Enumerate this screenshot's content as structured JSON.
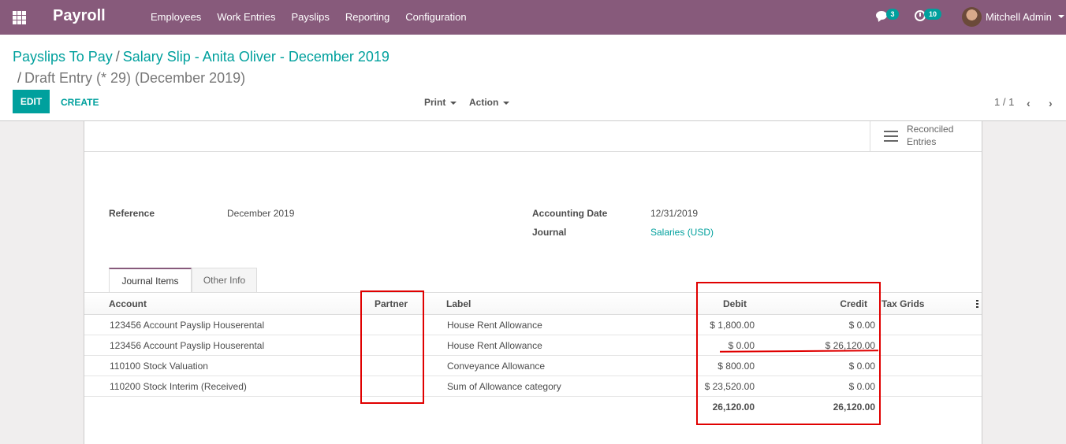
{
  "navbar": {
    "app_title": "Payroll",
    "menu": [
      "Employees",
      "Work Entries",
      "Payslips",
      "Reporting",
      "Configuration"
    ],
    "chat_badge": "3",
    "activity_badge": "10",
    "user_name": "Mitchell Admin",
    "brand_color": "#875a7b"
  },
  "breadcrumb": {
    "parent1": "Payslips To Pay",
    "parent2": "Salary Slip - Anita Oliver - December 2019",
    "current": "Draft Entry (* 29) (December 2019)",
    "separator": "/"
  },
  "toolbar": {
    "edit_label": "EDIT",
    "create_label": "CREATE",
    "print_label": "Print",
    "action_label": "Action",
    "pager": "1 / 1",
    "accent_color": "#00a09d"
  },
  "smart_button": {
    "label_line1": "Reconciled",
    "label_line2": "Entries",
    "icon": "list-icon"
  },
  "form": {
    "reference_label": "Reference",
    "reference_value": "December 2019",
    "accounting_date_label": "Accounting Date",
    "accounting_date_value": "12/31/2019",
    "journal_label": "Journal",
    "journal_value": "Salaries (USD)"
  },
  "tabs": [
    "Journal Items",
    "Other Info"
  ],
  "table": {
    "headers": {
      "account": "Account",
      "partner": "Partner",
      "label": "Label",
      "debit": "Debit",
      "credit": "Credit",
      "tax_grids": "Tax Grids"
    },
    "rows": [
      {
        "account": "123456 Account Payslip Houserental",
        "partner": "",
        "label": "House Rent Allowance",
        "debit": "$ 1,800.00",
        "credit": "$ 0.00"
      },
      {
        "account": "123456 Account Payslip Houserental",
        "partner": "",
        "label": "House Rent Allowance",
        "debit": "$ 0.00",
        "credit": "$ 26,120.00"
      },
      {
        "account": "110100 Stock Valuation",
        "partner": "",
        "label": "Conveyance Allowance",
        "debit": "$ 800.00",
        "credit": "$ 0.00"
      },
      {
        "account": "110200 Stock Interim (Received)",
        "partner": "",
        "label": "Sum of Allowance category",
        "debit": "$ 23,520.00",
        "credit": "$ 0.00"
      }
    ],
    "totals": {
      "debit": "26,120.00",
      "credit": "26,120.00"
    }
  },
  "annotation_color": "#e00000"
}
